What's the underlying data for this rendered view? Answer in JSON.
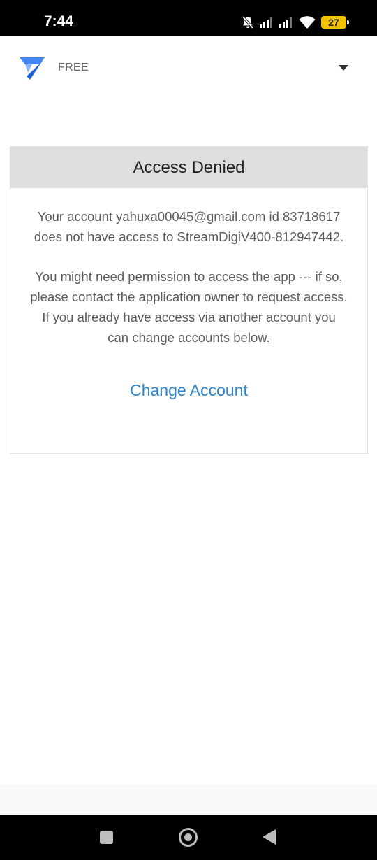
{
  "status_bar": {
    "time": "7:44",
    "battery": "27",
    "icons": [
      "bell-off-icon",
      "signal-icon",
      "signal-icon",
      "wifi-icon",
      "battery-icon"
    ]
  },
  "header": {
    "logo": "appsheet-logo-icon",
    "plan": "FREE",
    "dropdown": "caret-down-icon"
  },
  "dialog": {
    "title": "Access Denied",
    "message_account": "Your account yahuxa00045@gmail.com id 83718617 does not have access to StreamDigiV400-812947442.",
    "message_permission": "You might need permission to access the app --- if so, please contact the application owner to request access. If you already have access via another account you can change accounts below.",
    "change_account_label": "Change Account"
  },
  "nav_bar": {
    "buttons": [
      "recents-icon",
      "home-icon",
      "back-icon"
    ]
  },
  "colors": {
    "link": "#2b83c7",
    "header_bg": "#dedede",
    "logo_blue": "#4285f4",
    "battery": "#f2c100"
  }
}
